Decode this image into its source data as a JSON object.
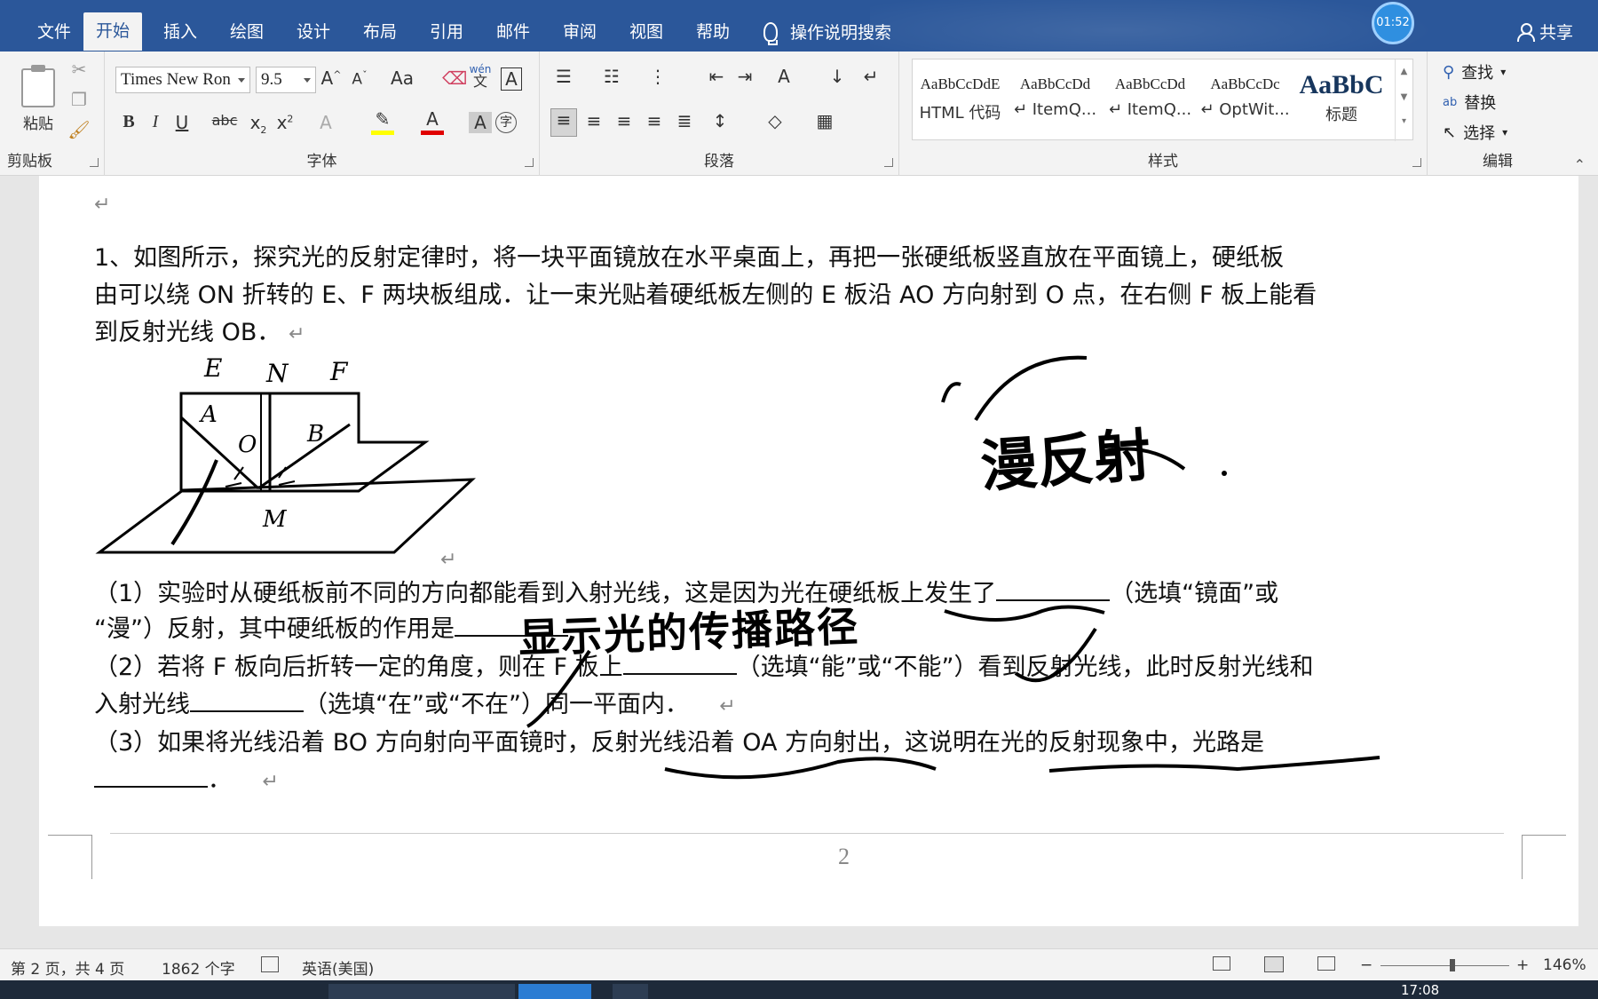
{
  "tabs": [
    "文件",
    "开始",
    "插入",
    "绘图",
    "设计",
    "布局",
    "引用",
    "邮件",
    "审阅",
    "视图",
    "帮助"
  ],
  "active_tab": "开始",
  "tell_me": "操作说明搜索",
  "share": "共享",
  "timer": "01:52",
  "ribbon": {
    "clipboard": {
      "paste": "粘贴",
      "label": "剪贴板"
    },
    "font": {
      "name": "Times New Ron",
      "size": "9.5",
      "label": "字体",
      "phonetic_top": "wén",
      "phonetic_bottom": "文",
      "change_case": "Aa"
    },
    "paragraph": {
      "label": "段落"
    },
    "styles": {
      "label": "样式",
      "items": [
        {
          "preview": "AaBbCcDdE",
          "name": "HTML 代码"
        },
        {
          "preview": "AaBbCcDd",
          "name": "↵ ItemQ..."
        },
        {
          "preview": "AaBbCcDd",
          "name": "↵ ItemQ..."
        },
        {
          "preview": "AaBbCcDc",
          "name": "↵ OptWit..."
        },
        {
          "preview": "AaBbC",
          "name": "标题"
        }
      ]
    },
    "editing": {
      "find": "查找",
      "replace": "替换",
      "select": "选择",
      "label": "编辑"
    }
  },
  "document": {
    "pilcrow": "↵",
    "q1_lines": [
      "1、如图所示，探究光的反射定律时，将一块平面镜放在水平桌面上，再把一张硬纸板竖直放在平面镜上，硬纸板",
      "由可以绕 ON 折转的 E、F 两块板组成．让一束光贴着硬纸板左侧的 E 板沿 AO 方向射到 O 点，在右侧 F 板上能看",
      "到反射光线 OB．"
    ],
    "figure_labels": {
      "E": "E",
      "N": "N",
      "F": "F",
      "A": "A",
      "O": "O",
      "B": "B",
      "M": "M"
    },
    "sub1_a": "（1）实验时从硬纸板前不同的方向都能看到入射光线，这是因为光在硬纸板上发生了",
    "sub1_b": "（选填“镜面”或",
    "sub1_c": "“漫”）反射，其中硬纸板的作用是",
    "sub2_a": "（2）若将 F 板向后折转一定的角度，则在 F 板上",
    "sub2_b": "（选填“能”或“不能”）看到反射光线，此时反射光线和",
    "sub2_c": "入射光线",
    "sub2_d": "（选填“在”或“不在”）同一平面内．",
    "sub3_a": "（3）如果将光线沿着 BO 方向射向平面镜时，反射光线沿着 OA 方向射出，这说明在光的反射现象中，光路是",
    "sub3_end": "．",
    "handwriting_1": "漫反射",
    "handwriting_2": "显示光的传播路径",
    "page_number": "2"
  },
  "status": {
    "page": "第 2 页，共 4 页",
    "words": "1862 个字",
    "language": "英语(美国)",
    "zoom": "146%",
    "zoom_minus": "−",
    "zoom_plus": "+"
  },
  "taskbar": {
    "time": "17:08"
  }
}
